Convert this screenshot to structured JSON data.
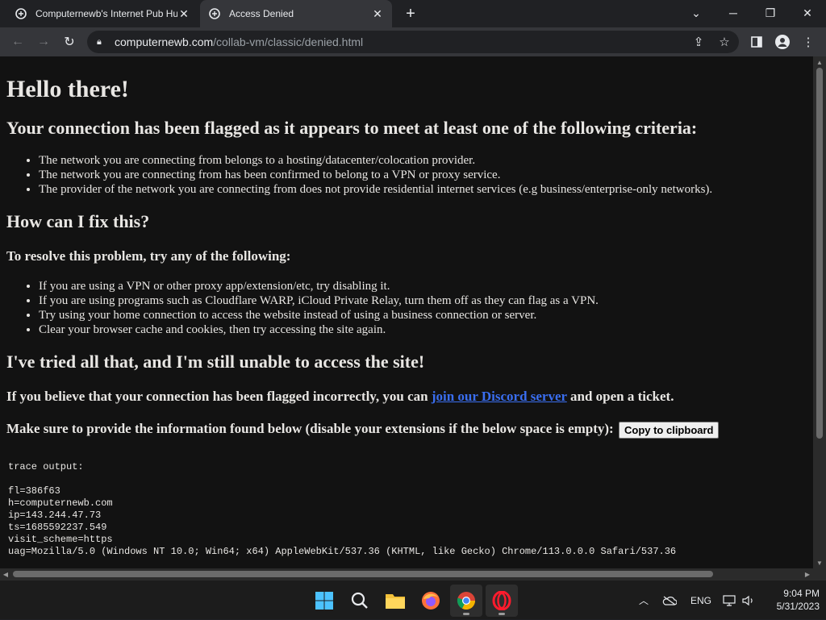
{
  "browser": {
    "tabs": [
      {
        "title": "Computernewb's Internet Pub Hu",
        "active": false
      },
      {
        "title": "Access Denied",
        "active": true
      }
    ],
    "url_host": "computernewb.com",
    "url_path": "/collab-vm/classic/denied.html"
  },
  "page": {
    "h1": "Hello there!",
    "h2_flagged": "Your connection has been flagged as it appears to meet at least one of the following criteria:",
    "criteria": [
      "The network you are connecting from belongs to a hosting/datacenter/colocation provider.",
      "The network you are connecting from has been confirmed to belong to a VPN or proxy service.",
      "The provider of the network you are connecting from does not provide residential internet services (e.g business/enterprise-only networks)."
    ],
    "h2_fix": "How can I fix this?",
    "h3_resolve": "To resolve this problem, try any of the following:",
    "fixes": [
      "If you are using a VPN or other proxy app/extension/etc, try disabling it.",
      "If you are using programs such as Cloudflare WARP, iCloud Private Relay, turn them off as they can flag as a VPN.",
      "Try using your home connection to access the website instead of using a business connection or server.",
      "Clear your browser cache and cookies, then try accessing the site again."
    ],
    "h2_tried": "I've tried all that, and I'm still unable to access the site!",
    "ticket_prefix": "If you believe that your connection has been flagged incorrectly, you can ",
    "ticket_link": "join our Discord server",
    "ticket_suffix": " and open a ticket.",
    "info_text": "Make sure to provide the information found below (disable your extensions if the below space is empty):",
    "copy_button": "Copy to clipboard",
    "trace_lines": [
      "trace output:",
      "",
      "fl=386f63",
      "h=computernewb.com",
      "ip=143.244.47.73",
      "ts=1685592237.549",
      "visit_scheme=https",
      "uag=Mozilla/5.0 (Windows NT 10.0; Win64; x64) AppleWebKit/537.36 (KHTML, like Gecko) Chrome/113.0.0.0 Safari/537.36"
    ]
  },
  "taskbar": {
    "language": "ENG",
    "time": "9:04 PM",
    "date": "5/31/2023"
  }
}
